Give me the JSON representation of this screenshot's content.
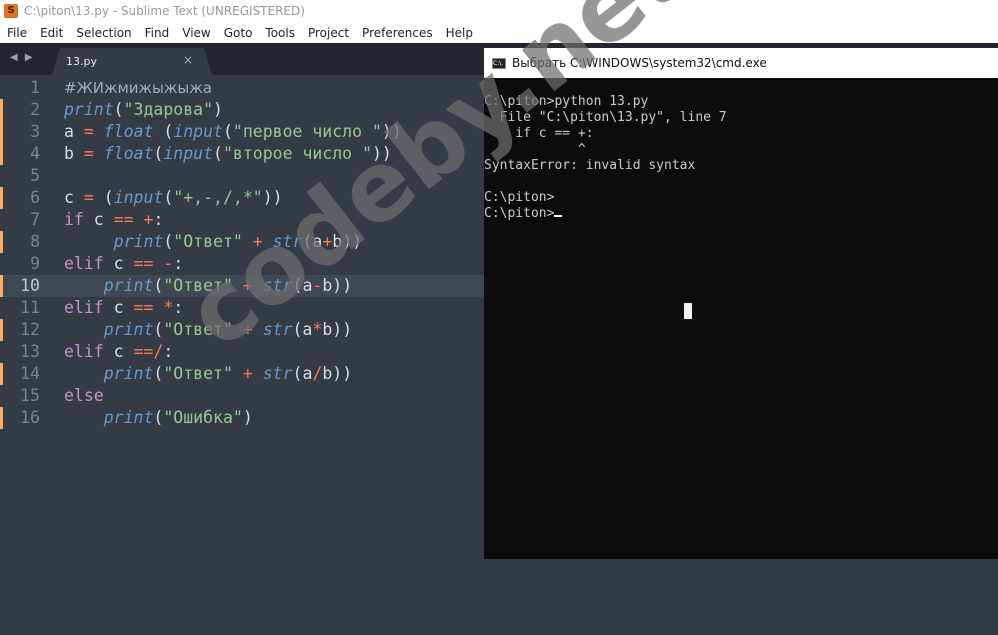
{
  "window": {
    "title": "C:\\piton\\13.py - Sublime Text (UNREGISTERED)",
    "app_icon": "sublime-icon"
  },
  "menu": [
    "File",
    "Edit",
    "Selection",
    "Find",
    "View",
    "Goto",
    "Tools",
    "Project",
    "Preferences",
    "Help"
  ],
  "tab": {
    "nav": "◀ ▶",
    "name": "13.py",
    "close": "×"
  },
  "editor": {
    "current_line": 10,
    "modified_lines": [
      2,
      3,
      4,
      6,
      8,
      10,
      12,
      14,
      16
    ],
    "lines": [
      [
        [
          "#ЖИжмижыжыжа",
          "cm"
        ]
      ],
      [
        [
          "print",
          "fn"
        ],
        [
          "(",
          ""
        ],
        [
          "\"Здарова\"",
          "st"
        ],
        [
          ")",
          ""
        ]
      ],
      [
        [
          "a ",
          ""
        ],
        [
          "=",
          "op"
        ],
        [
          " ",
          ""
        ],
        [
          "float",
          "fn"
        ],
        [
          " (",
          ""
        ],
        [
          "input",
          "fn"
        ],
        [
          "(",
          ""
        ],
        [
          "\"первое число \"",
          "st"
        ],
        [
          "))",
          ""
        ]
      ],
      [
        [
          "b ",
          ""
        ],
        [
          "=",
          "op"
        ],
        [
          " ",
          ""
        ],
        [
          "float",
          "fn"
        ],
        [
          "(",
          ""
        ],
        [
          "input",
          "fn"
        ],
        [
          "(",
          ""
        ],
        [
          "\"второе число \"",
          "st"
        ],
        [
          "))",
          ""
        ]
      ],
      [],
      [
        [
          "c ",
          ""
        ],
        [
          "=",
          "op"
        ],
        [
          " (",
          ""
        ],
        [
          "input",
          "fn"
        ],
        [
          "(",
          ""
        ],
        [
          "\"+,-,/,*\"",
          "st"
        ],
        [
          "))",
          ""
        ]
      ],
      [
        [
          "if",
          "kw"
        ],
        [
          " c ",
          ""
        ],
        [
          "==",
          "op"
        ],
        [
          " ",
          ""
        ],
        [
          "+",
          "op"
        ],
        [
          ":",
          ""
        ]
      ],
      [
        [
          "     ",
          ""
        ],
        [
          "print",
          "fn"
        ],
        [
          "(",
          ""
        ],
        [
          "\"Ответ\"",
          "st"
        ],
        [
          " ",
          ""
        ],
        [
          "+",
          "op"
        ],
        [
          " ",
          ""
        ],
        [
          "str",
          "fn"
        ],
        [
          "(a",
          ""
        ],
        [
          "+",
          "op"
        ],
        [
          "b))",
          ""
        ]
      ],
      [
        [
          "elif",
          "kw"
        ],
        [
          " c ",
          ""
        ],
        [
          "==",
          "op"
        ],
        [
          " ",
          ""
        ],
        [
          "-",
          "op"
        ],
        [
          ":",
          ""
        ]
      ],
      [
        [
          "    ",
          ""
        ],
        [
          "print",
          "fn"
        ],
        [
          "(",
          ""
        ],
        [
          "\"Ответ\"",
          "st"
        ],
        [
          " ",
          ""
        ],
        [
          "+",
          "op"
        ],
        [
          " ",
          ""
        ],
        [
          "str",
          "fn"
        ],
        [
          "(a",
          ""
        ],
        [
          "-",
          "op"
        ],
        [
          "b))",
          ""
        ]
      ],
      [
        [
          "elif",
          "kw"
        ],
        [
          " c ",
          ""
        ],
        [
          "==",
          "op"
        ],
        [
          " ",
          ""
        ],
        [
          "*",
          "op"
        ],
        [
          ":",
          ""
        ]
      ],
      [
        [
          "    ",
          ""
        ],
        [
          "print",
          "fn"
        ],
        [
          "(",
          ""
        ],
        [
          "\"Ответ\"",
          "st"
        ],
        [
          " ",
          ""
        ],
        [
          "+",
          "op"
        ],
        [
          " ",
          ""
        ],
        [
          "str",
          "fn"
        ],
        [
          "(a",
          ""
        ],
        [
          "*",
          "op"
        ],
        [
          "b))",
          ""
        ]
      ],
      [
        [
          "elif",
          "kw"
        ],
        [
          " c ",
          ""
        ],
        [
          "==/",
          "op"
        ],
        [
          ":",
          ""
        ]
      ],
      [
        [
          "    ",
          ""
        ],
        [
          "print",
          "fn"
        ],
        [
          "(",
          ""
        ],
        [
          "\"Ответ\"",
          "st"
        ],
        [
          " ",
          ""
        ],
        [
          "+",
          "op"
        ],
        [
          " ",
          ""
        ],
        [
          "str",
          "fn"
        ],
        [
          "(a",
          ""
        ],
        [
          "/",
          "op"
        ],
        [
          "b))",
          ""
        ]
      ],
      [
        [
          "else",
          "kw"
        ]
      ],
      [
        [
          "    ",
          ""
        ],
        [
          "print",
          "fn"
        ],
        [
          "(",
          ""
        ],
        [
          "\"Ошибка\"",
          "st"
        ],
        [
          ")",
          ""
        ]
      ]
    ]
  },
  "cmd": {
    "title": "Выбрать C:\\WINDOWS\\system32\\cmd.exe",
    "icon_text": "C:\\.",
    "output": "C:\\piton>python 13.py\n  File \"C:\\piton\\13.py\", line 7\n    if c == +:\n            ^\nSyntaxError: invalid syntax\n\nC:\\piton>\nC:\\piton>"
  },
  "watermark": "codeby.net"
}
